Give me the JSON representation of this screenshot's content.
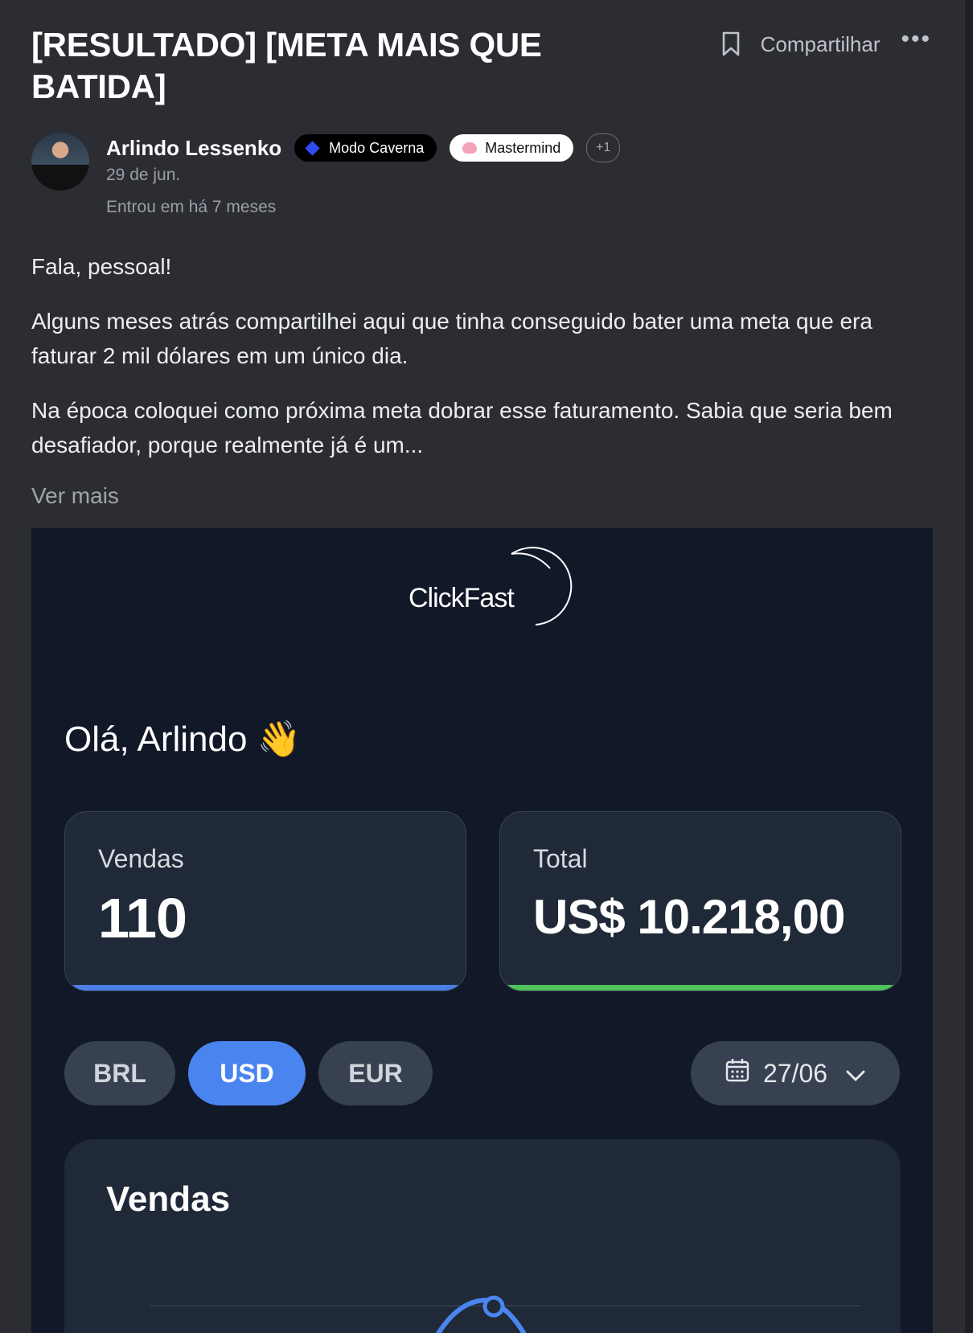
{
  "post": {
    "title": "[RESULTADO] [META MAIS QUE BATIDA]",
    "share_label": "Compartilhar",
    "more_label": "•••",
    "author": {
      "name": "Arlindo Lessenko",
      "badges": [
        "Modo Caverna",
        "Mastermind"
      ],
      "extra_badges": "+1",
      "date": "29 de jun.",
      "joined": "Entrou em há 7 meses"
    },
    "paragraphs": [
      "Fala, pessoal!",
      "Alguns meses atrás compartilhei aqui que tinha conseguido bater uma meta que era faturar 2 mil dólares em um único dia.",
      "Na época coloquei como próxima meta dobrar esse faturamento. Sabia que seria bem desafiador, porque realmente já é um..."
    ],
    "see_more": "Ver mais"
  },
  "dashboard": {
    "logo_text": "ClickFast",
    "greeting": "Olá, Arlindo 👋",
    "stats": [
      {
        "label": "Vendas",
        "value": "110",
        "bar_color": "#4a7fe8"
      },
      {
        "label": "Total",
        "value": "US$ 10.218,00",
        "bar_color": "#4fc25a"
      }
    ],
    "currencies": [
      "BRL",
      "USD",
      "EUR"
    ],
    "active_currency": "USD",
    "date_filter": "27/06",
    "chart_title": "Vendas"
  },
  "colors": {
    "background": "#2c2d33",
    "dashboard_bg": "#111827",
    "card_bg": "#1f2937",
    "accent_blue": "#4a84ef",
    "accent_green": "#4fc25a"
  }
}
